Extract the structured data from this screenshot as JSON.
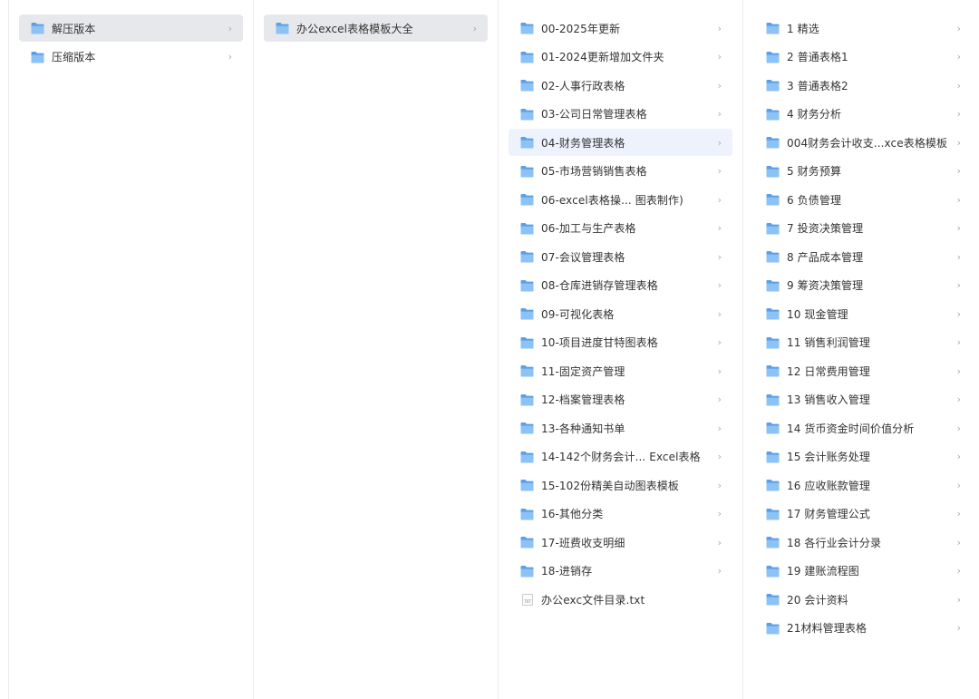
{
  "columns": [
    {
      "items": [
        {
          "label": "解压版本",
          "type": "folder",
          "state": "selected"
        },
        {
          "label": "压缩版本",
          "type": "folder",
          "state": ""
        }
      ]
    },
    {
      "items": [
        {
          "label": "办公excel表格模板大全",
          "type": "folder",
          "state": "selected"
        }
      ]
    },
    {
      "items": [
        {
          "label": "00-2025年更新",
          "type": "folder",
          "state": ""
        },
        {
          "label": "01-2024更新增加文件夹",
          "type": "folder",
          "state": ""
        },
        {
          "label": "02-人事行政表格",
          "type": "folder",
          "state": ""
        },
        {
          "label": "03-公司日常管理表格",
          "type": "folder",
          "state": ""
        },
        {
          "label": "04-财务管理表格",
          "type": "folder",
          "state": "highlighted"
        },
        {
          "label": "05-市场营销销售表格",
          "type": "folder",
          "state": ""
        },
        {
          "label": "06-excel表格操...  图表制作)",
          "type": "folder",
          "state": ""
        },
        {
          "label": "06-加工与生产表格",
          "type": "folder",
          "state": ""
        },
        {
          "label": "07-会议管理表格",
          "type": "folder",
          "state": ""
        },
        {
          "label": "08-仓库进销存管理表格",
          "type": "folder",
          "state": ""
        },
        {
          "label": "09-可视化表格",
          "type": "folder",
          "state": ""
        },
        {
          "label": "10-项目进度甘特图表格",
          "type": "folder",
          "state": ""
        },
        {
          "label": "11-固定资产管理",
          "type": "folder",
          "state": ""
        },
        {
          "label": "12-档案管理表格",
          "type": "folder",
          "state": ""
        },
        {
          "label": "13-各种通知书单",
          "type": "folder",
          "state": ""
        },
        {
          "label": "14-142个财务会计...  Excel表格",
          "type": "folder",
          "state": ""
        },
        {
          "label": "15-102份精美自动图表模板",
          "type": "folder",
          "state": ""
        },
        {
          "label": "16-其他分类",
          "type": "folder",
          "state": ""
        },
        {
          "label": "17-班费收支明细",
          "type": "folder",
          "state": ""
        },
        {
          "label": "18-进销存",
          "type": "folder",
          "state": ""
        },
        {
          "label": "办公exc文件目录.txt",
          "type": "txt",
          "state": ""
        }
      ]
    },
    {
      "items": [
        {
          "label": "1 精选",
          "type": "folder",
          "state": ""
        },
        {
          "label": "2 普通表格1",
          "type": "folder",
          "state": ""
        },
        {
          "label": "3 普通表格2",
          "type": "folder",
          "state": ""
        },
        {
          "label": "4 财务分析",
          "type": "folder",
          "state": ""
        },
        {
          "label": "004财务会计收支...xce表格模板",
          "type": "folder",
          "state": ""
        },
        {
          "label": "5 财务预算",
          "type": "folder",
          "state": ""
        },
        {
          "label": "6 负债管理",
          "type": "folder",
          "state": ""
        },
        {
          "label": "7 投资决策管理",
          "type": "folder",
          "state": ""
        },
        {
          "label": "8 产品成本管理",
          "type": "folder",
          "state": ""
        },
        {
          "label": "9 筹资决策管理",
          "type": "folder",
          "state": ""
        },
        {
          "label": "10 现金管理",
          "type": "folder",
          "state": ""
        },
        {
          "label": "11 销售利润管理",
          "type": "folder",
          "state": ""
        },
        {
          "label": "12 日常费用管理",
          "type": "folder",
          "state": ""
        },
        {
          "label": "13 销售收入管理",
          "type": "folder",
          "state": ""
        },
        {
          "label": "14 货币资金时间价值分析",
          "type": "folder",
          "state": ""
        },
        {
          "label": "15 会计账务处理",
          "type": "folder",
          "state": ""
        },
        {
          "label": "16 应收账款管理",
          "type": "folder",
          "state": ""
        },
        {
          "label": "17 财务管理公式",
          "type": "folder",
          "state": ""
        },
        {
          "label": "18 各行业会计分录",
          "type": "folder",
          "state": ""
        },
        {
          "label": "19 建账流程图",
          "type": "folder",
          "state": ""
        },
        {
          "label": "20 会计资料",
          "type": "folder",
          "state": ""
        },
        {
          "label": "21材料管理表格",
          "type": "folder",
          "state": ""
        }
      ]
    }
  ],
  "glyphs": {
    "chevron": "›",
    "txt_badge": "TXT"
  },
  "colors": {
    "folder_back": "#5aa0e8",
    "folder_front": "#8cc2f5",
    "selected_bg": "#e7e8eb",
    "highlight_bg": "#eef2fd",
    "chevron": "#a7a9ad"
  }
}
